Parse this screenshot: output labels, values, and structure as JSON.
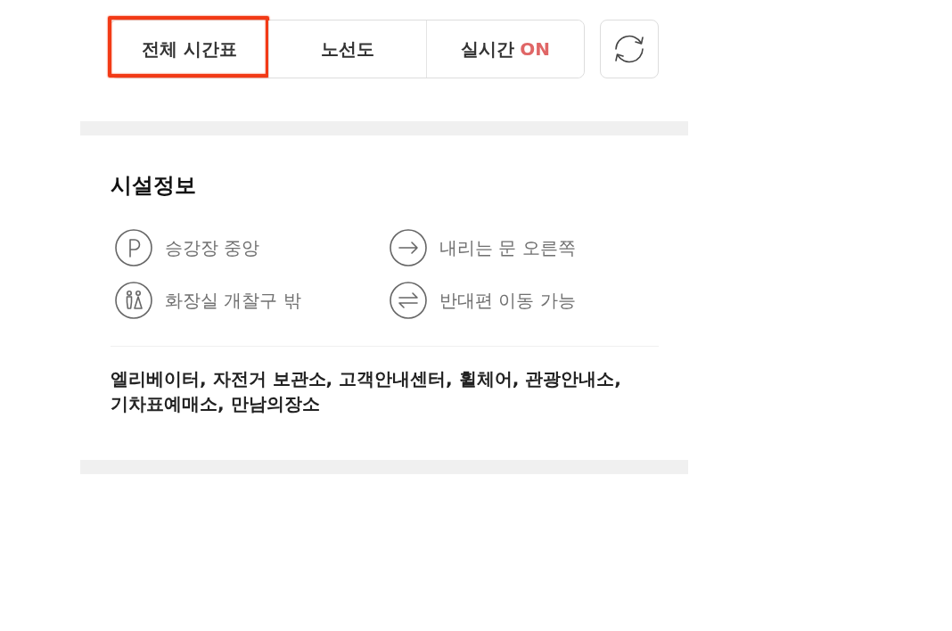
{
  "tabs": [
    {
      "label": "전체 시간표",
      "highlighted": true
    },
    {
      "label": "노선도",
      "highlighted": false
    },
    {
      "label": "실시간",
      "status": "ON",
      "highlighted": false
    }
  ],
  "facilities": {
    "title": "시설정보",
    "items": [
      {
        "kind": "platform",
        "label": "승강장 중앙"
      },
      {
        "kind": "exit",
        "label": "내리는 문 오른쪽"
      },
      {
        "kind": "restroom",
        "label": "화장실 개찰구 밖"
      },
      {
        "kind": "transfer",
        "label": "반대편 이동 가능"
      }
    ],
    "amenities": "엘리베이터, 자전거 보관소, 고객안내센터, 휠체어, 관광안내소, 기차표예매소, 만남의장소"
  }
}
